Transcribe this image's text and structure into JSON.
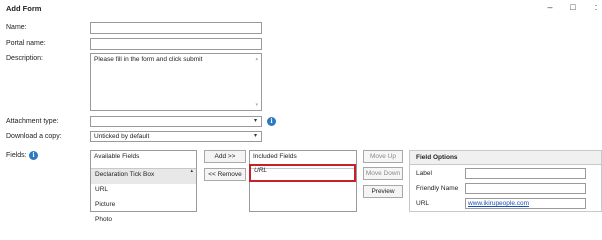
{
  "window": {
    "title": "Add Form",
    "minimize_glyph": "–",
    "maximize_glyph": "□",
    "close_glyph": ":"
  },
  "form": {
    "name_label": "Name:",
    "name_value": "",
    "portal_label": "Portal name:",
    "portal_value": "",
    "description_label": "Description:",
    "description_value": "Please fill in the form and click submit",
    "attachment_label": "Attachment type:",
    "attachment_value": "",
    "download_label": "Download a copy:",
    "download_value": "Unticked by default",
    "fields_label": "Fields:"
  },
  "fields": {
    "available_header": "Available Fields",
    "available_items": [
      "Declaration Tick Box",
      "URL",
      "Picture",
      "Photo"
    ],
    "included_header": "Included Fields",
    "included_items": [
      "URL"
    ],
    "add_label": "Add >>",
    "remove_label": "<< Remove",
    "move_up_label": "Move Up",
    "move_down_label": "Move Down",
    "preview_label": "Preview"
  },
  "field_options": {
    "header": "Field Options",
    "label_label": "Label",
    "label_value": "",
    "friendly_label": "Friendly Name",
    "friendly_value": "",
    "url_label": "URL",
    "url_value": "www.ikirupeople.com"
  },
  "icons": {
    "info_glyph": "i",
    "caret_glyph": "▾",
    "scroll_up_glyph": "▴",
    "scroll_down_glyph": "▾"
  },
  "colors": {
    "info_blue": "#2b79c2",
    "selection_red": "#c8202a",
    "link_blue": "#1a4fb5"
  }
}
